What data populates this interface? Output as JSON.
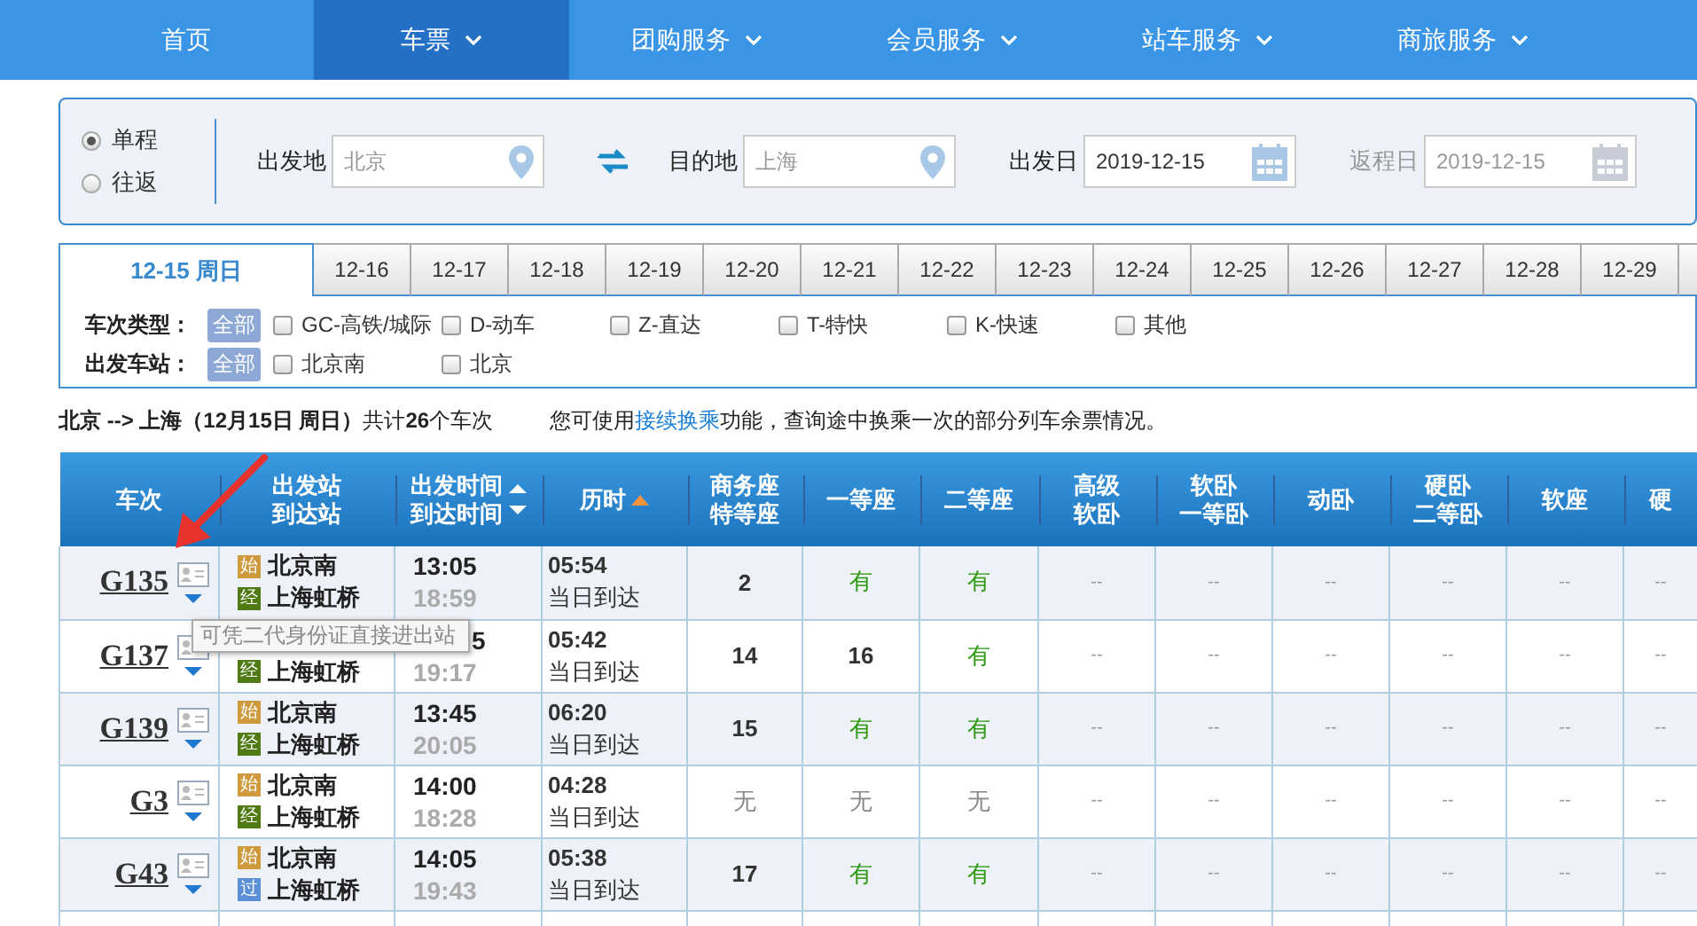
{
  "nav": [
    {
      "label": "首页",
      "selected": false,
      "has_menu": false
    },
    {
      "label": "车票",
      "selected": true,
      "has_menu": true
    },
    {
      "label": "团购服务",
      "selected": false,
      "has_menu": true
    },
    {
      "label": "会员服务",
      "selected": false,
      "has_menu": true
    },
    {
      "label": "站车服务",
      "selected": false,
      "has_menu": true
    },
    {
      "label": "商旅服务",
      "selected": false,
      "has_menu": true
    }
  ],
  "search": {
    "trip_types": [
      {
        "label": "单程",
        "selected": true
      },
      {
        "label": "往返",
        "selected": false
      }
    ],
    "fields": [
      {
        "kind": "place",
        "label": "出发地",
        "value": "北京",
        "disabled": false
      },
      {
        "kind": "place",
        "label": "目的地",
        "value": "上海",
        "disabled": false
      },
      {
        "kind": "date",
        "label": "出发日",
        "value": "2019-12-15",
        "disabled": false
      },
      {
        "kind": "date",
        "label": "返程日",
        "value": "2019-12-15",
        "disabled": true
      }
    ]
  },
  "date_tabs": [
    {
      "label": "12-15 周日",
      "selected": true
    },
    {
      "label": "12-16",
      "selected": false
    },
    {
      "label": "12-17",
      "selected": false
    },
    {
      "label": "12-18",
      "selected": false
    },
    {
      "label": "12-19",
      "selected": false
    },
    {
      "label": "12-20",
      "selected": false
    },
    {
      "label": "12-21",
      "selected": false
    },
    {
      "label": "12-22",
      "selected": false
    },
    {
      "label": "12-23",
      "selected": false
    },
    {
      "label": "12-24",
      "selected": false
    },
    {
      "label": "12-25",
      "selected": false
    },
    {
      "label": "12-26",
      "selected": false
    },
    {
      "label": "12-27",
      "selected": false
    },
    {
      "label": "12-28",
      "selected": false
    },
    {
      "label": "12-29",
      "selected": false
    }
  ],
  "filters": [
    {
      "label": "车次类型：",
      "all": "全部",
      "all_selected": true,
      "options": [
        {
          "label": "GC-高铁/城际",
          "checked": false
        },
        {
          "label": "D-动车",
          "checked": false
        },
        {
          "label": "Z-直达",
          "checked": false
        },
        {
          "label": "T-特快",
          "checked": false
        },
        {
          "label": "K-快速",
          "checked": false
        },
        {
          "label": "其他",
          "checked": false
        }
      ]
    },
    {
      "label": "出发车站：",
      "all": "全部",
      "all_selected": true,
      "options": [
        {
          "label": "北京南",
          "checked": false
        },
        {
          "label": "北京",
          "checked": false
        }
      ]
    }
  ],
  "summary": "**北京 --> 上海（12月15日  周日）**共计**26**个车次",
  "note": {
    "before": "您可使用",
    "link": "接续换乘",
    "after": "功能，查询途中换乘一次的部分列车余票情况。"
  },
  "table": {
    "columns": [
      {
        "lines": [
          "车次"
        ]
      },
      {
        "lines": [
          "出发站",
          "到达站"
        ]
      },
      {
        "lines": [
          "出发时间",
          "到达时间"
        ],
        "sortable": true,
        "sorted": false
      },
      {
        "lines": [
          "历时"
        ],
        "sortable": true,
        "sorted": true
      },
      {
        "lines": [
          "商务座",
          "特等座"
        ]
      },
      {
        "lines": [
          "一等座"
        ]
      },
      {
        "lines": [
          "二等座"
        ]
      },
      {
        "lines": [
          "高级",
          "软卧"
        ]
      },
      {
        "lines": [
          "软卧",
          "一等卧"
        ]
      },
      {
        "lines": [
          "动卧"
        ]
      },
      {
        "lines": [
          "硬卧",
          "二等卧"
        ]
      },
      {
        "lines": [
          "软座"
        ]
      },
      {
        "lines": [
          "硬"
        ]
      }
    ],
    "rows": [
      {
        "train": "G135",
        "stations": [
          {
            "tag": "始",
            "name": "北京南",
            "color": "#cf9a3e"
          },
          {
            "tag": "经",
            "name": "上海虹桥",
            "color": "#4f7a14"
          }
        ],
        "depart": "13:05",
        "arrive": "18:59",
        "duration": "05:54",
        "arrival_note": "当日到达",
        "seats": [
          {
            "text": "2",
            "kind": "count"
          },
          {
            "text": "有",
            "kind": "yes"
          },
          {
            "text": "有",
            "kind": "yes"
          },
          {
            "text": "--",
            "kind": "na"
          },
          {
            "text": "--",
            "kind": "na"
          },
          {
            "text": "--",
            "kind": "na"
          },
          {
            "text": "--",
            "kind": "na"
          },
          {
            "text": "--",
            "kind": "na"
          },
          {
            "text": "--",
            "kind": "na"
          }
        ]
      },
      {
        "train": "G137",
        "tooltip": "可凭二代身份证直接进出站",
        "stations": [
          {
            "tag": "经",
            "name": "上海虹桥",
            "color": "#4f7a14"
          }
        ],
        "depart": "5",
        "arrive": "19:17",
        "duration": "05:42",
        "arrival_note": "当日到达",
        "seats": [
          {
            "text": "14",
            "kind": "count"
          },
          {
            "text": "16",
            "kind": "count"
          },
          {
            "text": "有",
            "kind": "yes"
          },
          {
            "text": "--",
            "kind": "na"
          },
          {
            "text": "--",
            "kind": "na"
          },
          {
            "text": "--",
            "kind": "na"
          },
          {
            "text": "--",
            "kind": "na"
          },
          {
            "text": "--",
            "kind": "na"
          },
          {
            "text": "--",
            "kind": "na"
          }
        ]
      },
      {
        "train": "G139",
        "stations": [
          {
            "tag": "始",
            "name": "北京南",
            "color": "#cf9a3e"
          },
          {
            "tag": "经",
            "name": "上海虹桥",
            "color": "#4f7a14"
          }
        ],
        "depart": "13:45",
        "arrive": "20:05",
        "duration": "06:20",
        "arrival_note": "当日到达",
        "seats": [
          {
            "text": "15",
            "kind": "count"
          },
          {
            "text": "有",
            "kind": "yes"
          },
          {
            "text": "有",
            "kind": "yes"
          },
          {
            "text": "--",
            "kind": "na"
          },
          {
            "text": "--",
            "kind": "na"
          },
          {
            "text": "--",
            "kind": "na"
          },
          {
            "text": "--",
            "kind": "na"
          },
          {
            "text": "--",
            "kind": "na"
          },
          {
            "text": "--",
            "kind": "na"
          }
        ]
      },
      {
        "train": "G3",
        "stations": [
          {
            "tag": "始",
            "name": "北京南",
            "color": "#cf9a3e"
          },
          {
            "tag": "经",
            "name": "上海虹桥",
            "color": "#4f7a14"
          }
        ],
        "depart": "14:00",
        "arrive": "18:28",
        "duration": "04:28",
        "arrival_note": "当日到达",
        "seats": [
          {
            "text": "无",
            "kind": "none"
          },
          {
            "text": "无",
            "kind": "none"
          },
          {
            "text": "无",
            "kind": "none"
          },
          {
            "text": "--",
            "kind": "na"
          },
          {
            "text": "--",
            "kind": "na"
          },
          {
            "text": "--",
            "kind": "na"
          },
          {
            "text": "--",
            "kind": "na"
          },
          {
            "text": "--",
            "kind": "na"
          },
          {
            "text": "--",
            "kind": "na"
          }
        ]
      },
      {
        "train": "G43",
        "stations": [
          {
            "tag": "始",
            "name": "北京南",
            "color": "#cf9a3e"
          },
          {
            "tag": "过",
            "name": "上海虹桥",
            "color": "#5b8fd6"
          }
        ],
        "depart": "14:05",
        "arrive": "19:43",
        "duration": "05:38",
        "arrival_note": "当日到达",
        "seats": [
          {
            "text": "17",
            "kind": "count"
          },
          {
            "text": "有",
            "kind": "yes"
          },
          {
            "text": "有",
            "kind": "yes"
          },
          {
            "text": "--",
            "kind": "na"
          },
          {
            "text": "--",
            "kind": "na"
          },
          {
            "text": "--",
            "kind": "na"
          },
          {
            "text": "--",
            "kind": "na"
          },
          {
            "text": "--",
            "kind": "na"
          },
          {
            "text": "--",
            "kind": "na"
          }
        ]
      }
    ]
  }
}
